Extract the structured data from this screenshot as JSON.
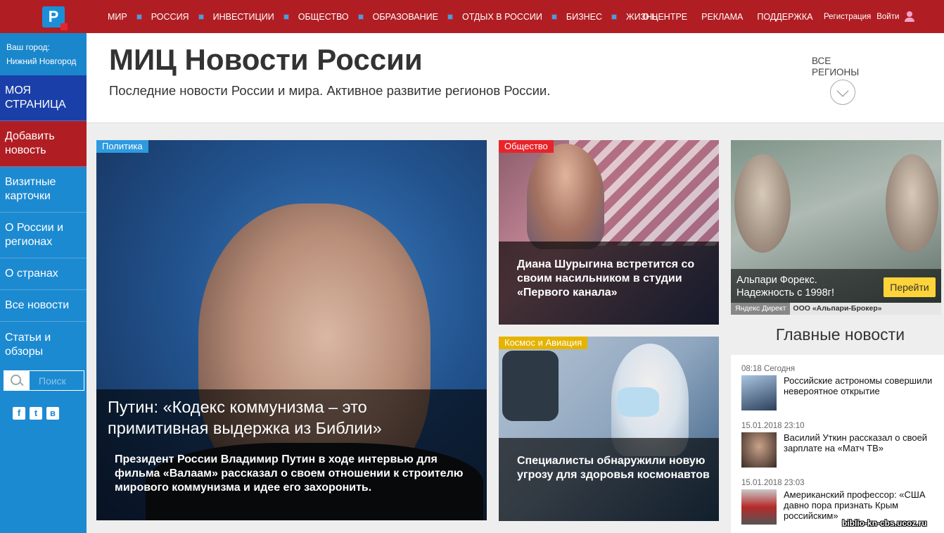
{
  "logo": {
    "letter": "Р"
  },
  "nav": {
    "items": [
      "МИР",
      "РОССИЯ",
      "ИНВЕСТИЦИИ",
      "ОБЩЕСТВО",
      "ОБРАЗОВАНИЕ",
      "ОТДЫХ В РОССИИ",
      "БИЗНЕС",
      "ЖИЗНЬ"
    ],
    "secondary": [
      "О ЦЕНТРЕ",
      "РЕКЛАМА",
      "ПОДДЕРЖКА"
    ],
    "register": "Регистрация",
    "login": "Войти"
  },
  "sidebar": {
    "city_label": "Ваш город:",
    "city_value": "Нижний Новгород",
    "items": [
      "МОЯ СТРАНИЦА",
      "Добавить новость",
      "Визитные карточки",
      "О России и регионах",
      "О странах",
      "Все новости",
      "Статьи и обзоры"
    ],
    "search_placeholder": "Поиск",
    "social": [
      "f",
      "t",
      "в"
    ]
  },
  "header": {
    "title": "МИЦ Новости России",
    "subtitle": "Последние новости России и мира. Активное развитие регионов России.",
    "regions_line1": "ВСЕ",
    "regions_line2": "РЕГИОНЫ"
  },
  "main_story": {
    "category": "Политика",
    "title": "Путин: «Кодекс коммунизма – это примитивная выдержка из Библии»",
    "lead": "Президент России Владимир Путин в ходе интервью для фильма «Валаам» рассказал о своем отношении к строителю мирового коммунизма и идее его захоронить."
  },
  "stories": [
    {
      "category": "Общество",
      "title": "Диана Шурыгина встретится со своим насильником в студии «Первого канала»",
      "tag_color": "#e8242b"
    },
    {
      "category": "Космос и Авиация",
      "title": "Специалисты обнаружили новую угрозу для здоровья космонавтов",
      "tag_color": "#e5b300"
    }
  ],
  "main_tag_color": "#2e9ae0",
  "ad": {
    "text": "Альпари Форекс. Надежность с 1998г!",
    "button": "Перейти",
    "network": "Яндекс Директ",
    "org": "ООО «Альпари-Брокер»"
  },
  "main_news": {
    "title": "Главные новости",
    "items": [
      {
        "time": "08:18 Сегодня",
        "text": "Российские астрономы совершили невероятное открытие"
      },
      {
        "time": "15.01.2018 23:10",
        "text": "Василий Уткин рассказал о своей зарплате на «Матч ТВ»"
      },
      {
        "time": "15.01.2018 23:03",
        "text": "Американский профессор: «США давно пора признать Крым российским»"
      }
    ]
  },
  "watermark": "biblio-kn-cbs.ucoz.ru",
  "colors": {
    "topbar": "#b01e23",
    "sidebar": "#1c8ad1",
    "my_page": "#1a3fa8"
  }
}
